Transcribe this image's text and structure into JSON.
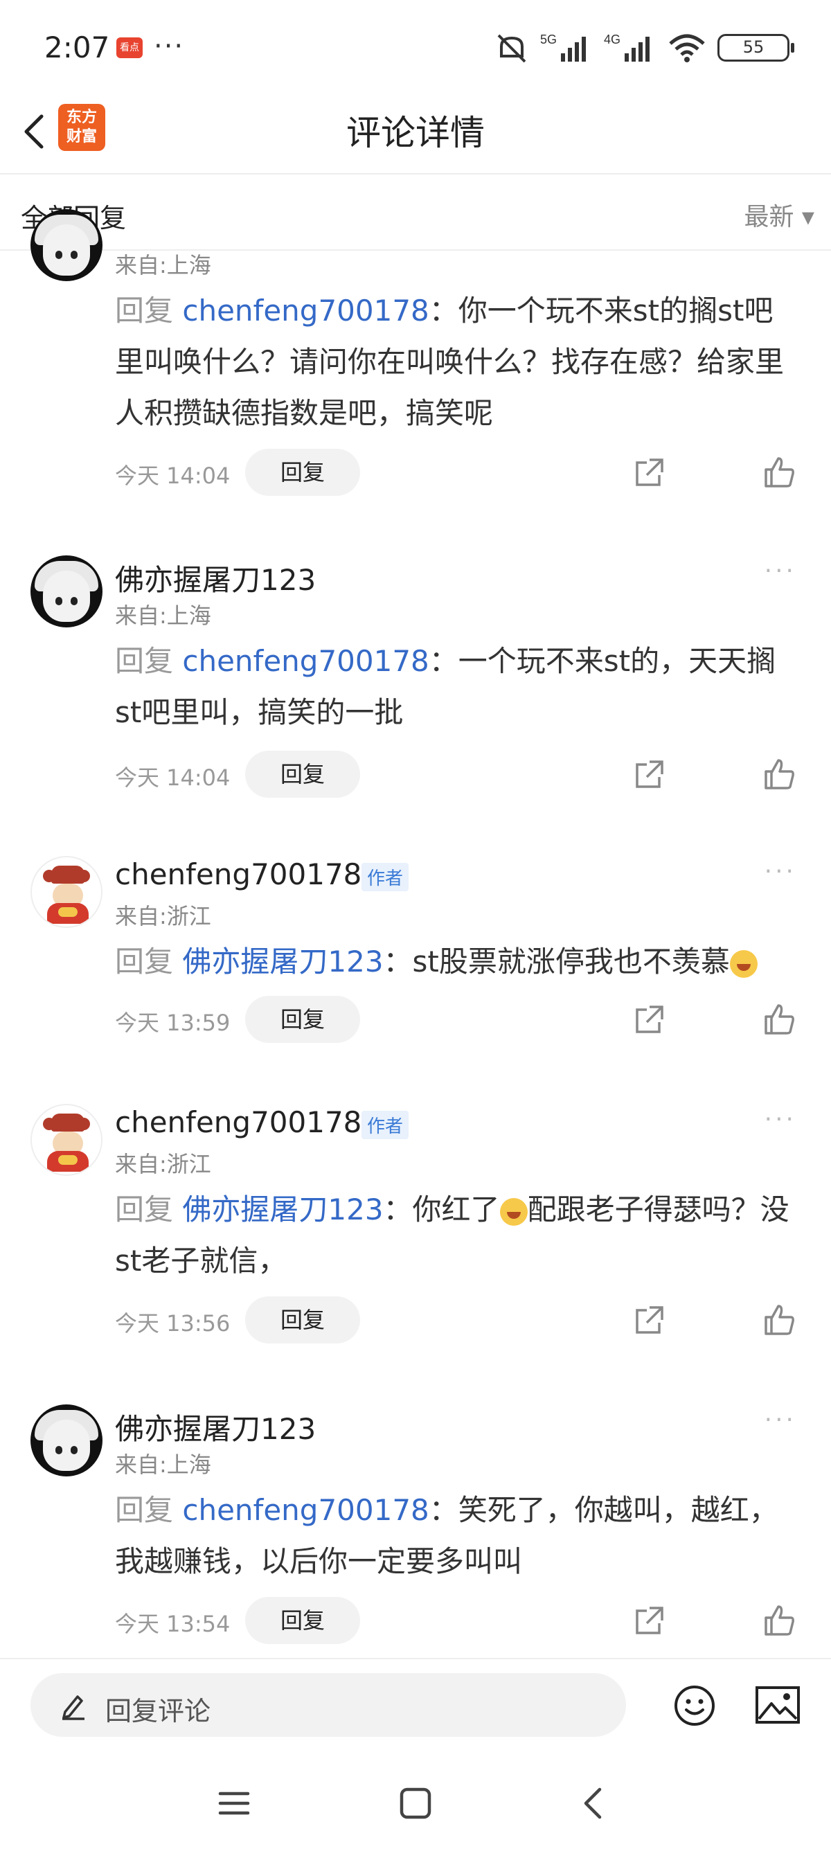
{
  "status_bar": {
    "time": "2:07",
    "app_badge": "看点",
    "dots": "···",
    "signal_5g": "5G",
    "signal_4g": "4G",
    "battery": "55"
  },
  "header": {
    "logo": "东方\n财富",
    "title": "评论详情"
  },
  "subheader": {
    "all_replies": "全部回复",
    "sort": "最新 ▾"
  },
  "comments": [
    {
      "location": "来自:上海",
      "reply_word": "回复",
      "mention": "chenfeng700178",
      "text": "：你一个玩不来st的搁st吧里叫唤什么？请问你在叫唤什么？找存在感？给家里人积攒缺德指数是吧，搞笑呢",
      "time": "今天 14:04",
      "reply_btn": "回复"
    },
    {
      "name": "佛亦握屠刀123",
      "location": "来自:上海",
      "reply_word": "回复",
      "mention": "chenfeng700178",
      "text": "：一个玩不来st的，天天搁st吧里叫，搞笑的一批",
      "time": "今天 14:04",
      "reply_btn": "回复"
    },
    {
      "name": "chenfeng700178",
      "tag": "作者",
      "location": "来自:浙江",
      "reply_word": "回复",
      "mention": "佛亦握屠刀123",
      "text": "：st股票就涨停我也不羡慕",
      "time": "今天 13:59",
      "reply_btn": "回复"
    },
    {
      "name": "chenfeng700178",
      "tag": "作者",
      "location": "来自:浙江",
      "reply_word": "回复",
      "mention": "佛亦握屠刀123",
      "text_a": "：你红了",
      "text_b": "配跟老子得瑟吗？没st老子就信，",
      "time": "今天 13:56",
      "reply_btn": "回复"
    },
    {
      "name": "佛亦握屠刀123",
      "location": "来自:上海",
      "reply_word": "回复",
      "mention": "chenfeng700178",
      "text": "：笑死了，你越叫，越红，我越赚钱，以后你一定要多叫叫",
      "time": "今天 13:54",
      "reply_btn": "回复"
    }
  ],
  "more": "···",
  "bottom": {
    "placeholder": "回复评论"
  }
}
